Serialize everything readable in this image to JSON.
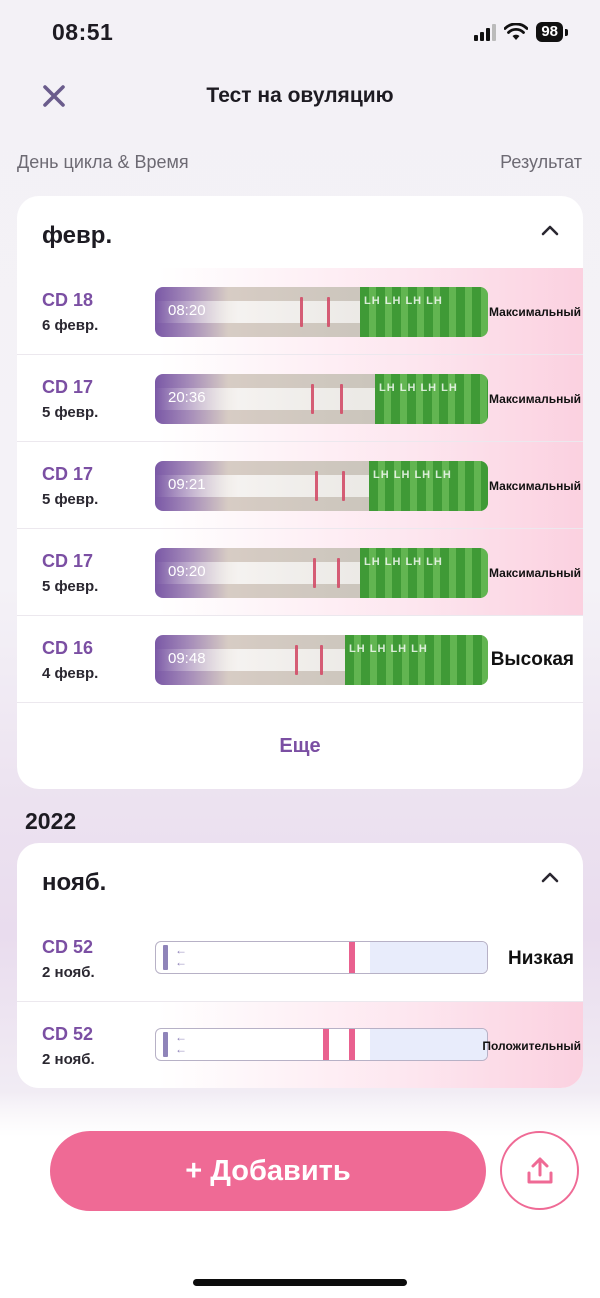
{
  "status_bar": {
    "time": "08:51",
    "battery": "98"
  },
  "nav": {
    "title": "Тест на овуляцию"
  },
  "columns": {
    "left": "День цикла & Время",
    "right": "Результат"
  },
  "sections": [
    {
      "month": "февр.",
      "rows": [
        {
          "cd": "CD 18",
          "date": "6 февр.",
          "time": "08:20",
          "result": "Максимальный"
        },
        {
          "cd": "CD 17",
          "date": "5 февр.",
          "time": "20:36",
          "result": "Максимальный"
        },
        {
          "cd": "CD 17",
          "date": "5 февр.",
          "time": "09:21",
          "result": "Максимальный"
        },
        {
          "cd": "CD 17",
          "date": "5 февр.",
          "time": "09:20",
          "result": "Максимальный"
        },
        {
          "cd": "CD 16",
          "date": "4 февр.",
          "time": "09:48",
          "result": "Высокая"
        }
      ],
      "more_label": "Еще"
    },
    {
      "year": "2022",
      "month": "нояб.",
      "rows": [
        {
          "cd": "CD 52",
          "date": "2 нояб.",
          "result": "Низкая"
        },
        {
          "cd": "CD 52",
          "date": "2 нояб.",
          "result": "Положительный"
        }
      ]
    }
  ],
  "actions": {
    "add_label": "+ Добавить"
  },
  "colors": {
    "accent": "#ef6a95",
    "purple": "#7b4fa3"
  },
  "icons": [
    "close-icon",
    "chevron-up-icon",
    "share-icon",
    "signal-icon",
    "wifi-icon",
    "battery-icon"
  ]
}
